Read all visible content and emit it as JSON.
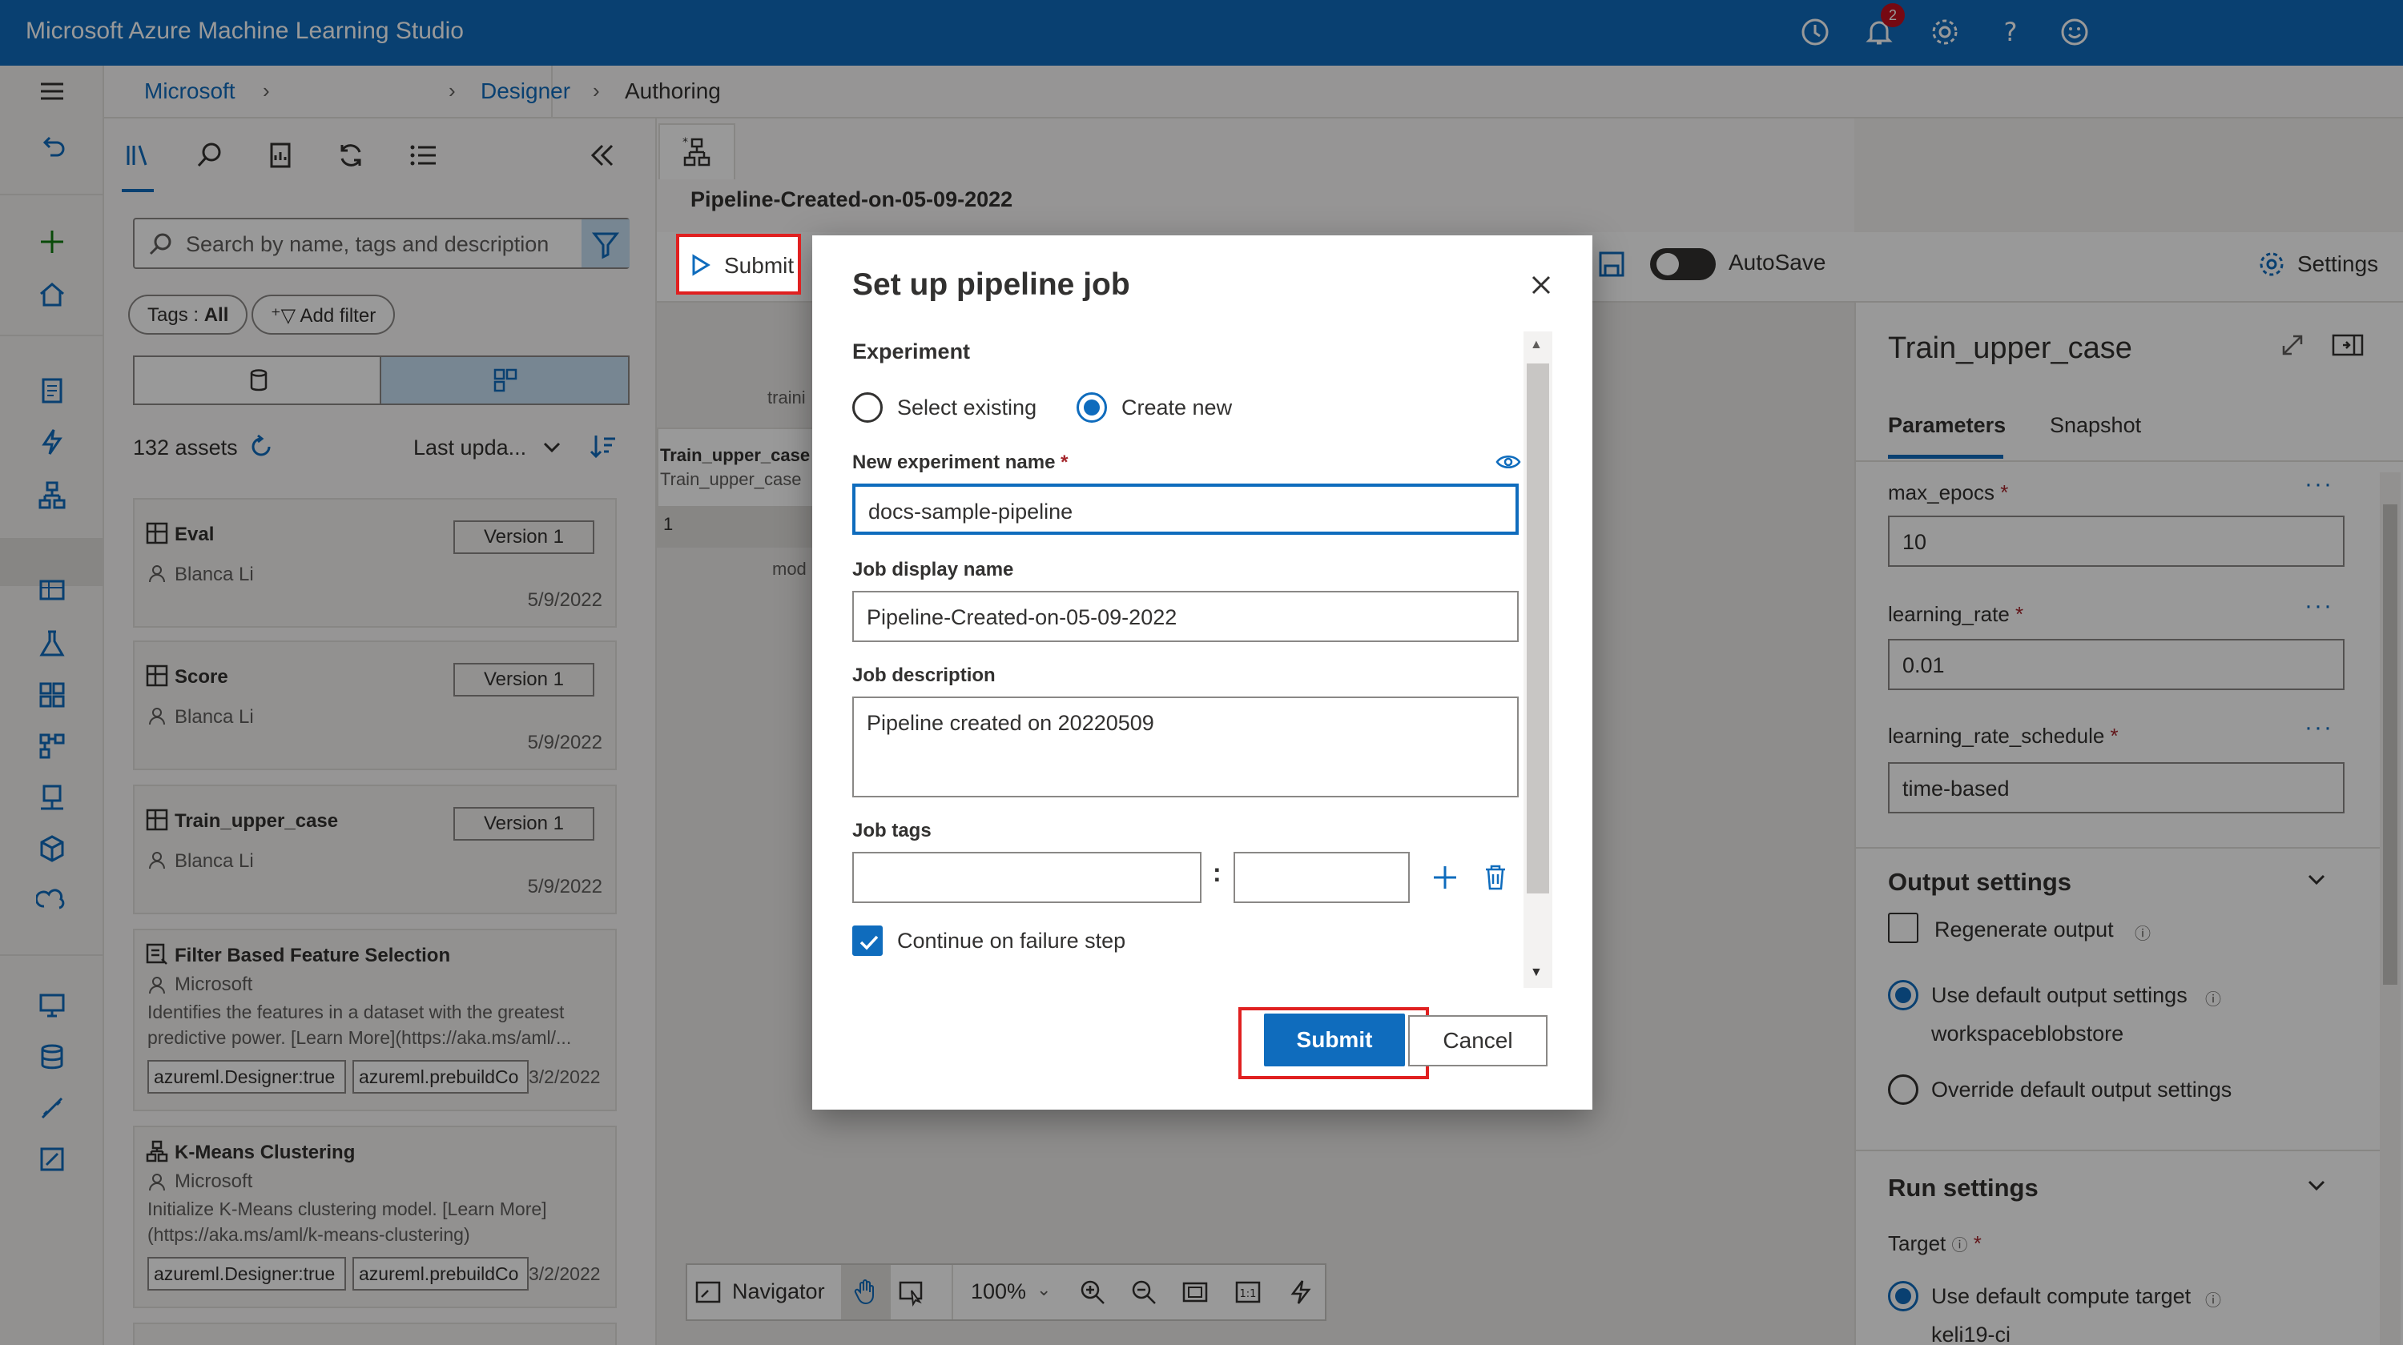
{
  "app": {
    "title": "Microsoft Azure Machine Learning Studio",
    "notifications_count": "2"
  },
  "breadcrumb": {
    "items": [
      "Microsoft",
      "Designer",
      "Authoring"
    ]
  },
  "library": {
    "search_placeholder": "Search by name, tags and description",
    "tags_prefix": "Tags : ",
    "tags_value": "All",
    "add_filter": "Add filter",
    "assets_count": "132 assets",
    "sort_label": "Last upda...",
    "cards": [
      {
        "title": "Eval",
        "author": "Blanca Li",
        "date": "5/9/2022",
        "version": "Version 1"
      },
      {
        "title": "Score",
        "author": "Blanca Li",
        "date": "5/9/2022",
        "version": "Version 1"
      },
      {
        "title": "Train_upper_case",
        "author": "Blanca Li",
        "date": "5/9/2022",
        "version": "Version 1"
      },
      {
        "title": "Filter Based Feature Selection",
        "author": "Microsoft",
        "desc": "Identifies the features in a dataset with the greatest predictive power. [Learn More](https://aka.ms/aml/...",
        "tag1": "azureml.Designer:true",
        "tag2": "azureml.prebuildCo",
        "date": "3/2/2022"
      },
      {
        "title": "K-Means Clustering",
        "author": "Microsoft",
        "desc": "Initialize K-Means clustering model. [Learn More](https://aka.ms/aml/k-means-clustering)",
        "tag1": "azureml.Designer:true",
        "tag2": "azureml.prebuildCo",
        "date": "3/2/2022"
      }
    ]
  },
  "canvas": {
    "pipeline_name": "Pipeline-Created-on-05-09-2022",
    "submit": "Submit",
    "autosave": "AutoSave",
    "settings": "Settings",
    "node_title": "Train_upper_case",
    "node_subtitle": "Train_upper_case",
    "node_port": "1",
    "label_top": "traini",
    "label_bottom": "mod",
    "navigator": "Navigator",
    "zoom": "100%"
  },
  "right_panel": {
    "title": "Train_upper_case",
    "tabs": [
      "Parameters",
      "Snapshot"
    ],
    "params": [
      {
        "label": "max_epocs",
        "value": "10"
      },
      {
        "label": "learning_rate",
        "value": "0.01"
      },
      {
        "label": "learning_rate_schedule",
        "value": "time-based"
      }
    ],
    "required_mark": "*",
    "output_settings": "Output settings",
    "regenerate_output": "Regenerate output",
    "use_default_output": "Use default output settings",
    "default_datastore": "workspaceblobstore",
    "override_output": "Override default output settings",
    "run_settings": "Run settings",
    "target": "Target",
    "use_default_compute": "Use default compute target",
    "compute_name": "keli19-ci"
  },
  "modal": {
    "title": "Set up pipeline job",
    "experiment": "Experiment",
    "select_existing": "Select existing",
    "create_new": "Create new",
    "new_experiment_label": "New experiment name",
    "required_mark": "*",
    "new_experiment_value": "docs-sample-pipeline",
    "display_name_label": "Job display name",
    "display_name_value": "Pipeline-Created-on-05-09-2022",
    "description_label": "Job description",
    "description_value": "Pipeline created on 20220509",
    "tags_label": "Job tags",
    "tag_separator": ":",
    "continue_on_failure": "Continue on failure step",
    "submit": "Submit",
    "cancel": "Cancel"
  },
  "colors": {
    "brand": "#0f6cbd",
    "highlight": "#e02020"
  }
}
